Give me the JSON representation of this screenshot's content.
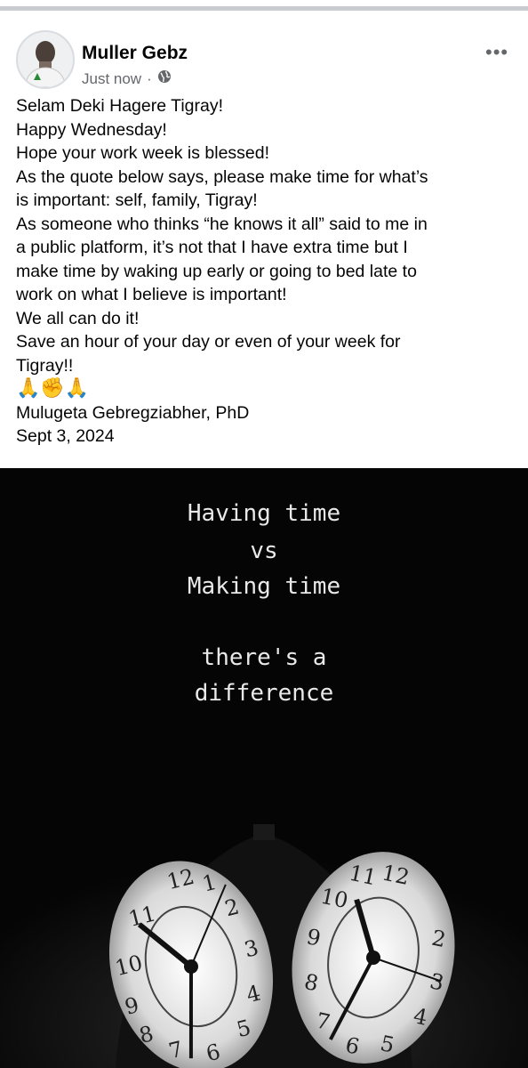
{
  "post": {
    "author": "Muller Gebz",
    "time": "Just now",
    "separator": "·",
    "lines": [
      "Selam Deki Hagere Tigray!",
      "Happy Wednesday!",
      "Hope your work week is blessed!",
      "As the quote below says, please make time for what’s",
      "is important: self, family, Tigray!",
      "As someone who thinks “he knows it all” said to me in",
      "a public platform, it’s not that I have extra time but I",
      "make time by waking up early or going to bed late to",
      "work on what I believe is important!",
      "We all can do it!",
      "Save an hour of your day or even of your week for",
      "Tigray!!"
    ],
    "emoji": "🙏✊🙏",
    "signature": "Mulugeta Gebregziabher, PhD",
    "date": "Sept 3, 2024"
  },
  "image": {
    "quote_lines": [
      "Having time",
      "vs",
      "Making time",
      "there's a",
      "difference"
    ]
  },
  "icons": {
    "privacy": "globe-icon",
    "more": "more-options-icon"
  }
}
